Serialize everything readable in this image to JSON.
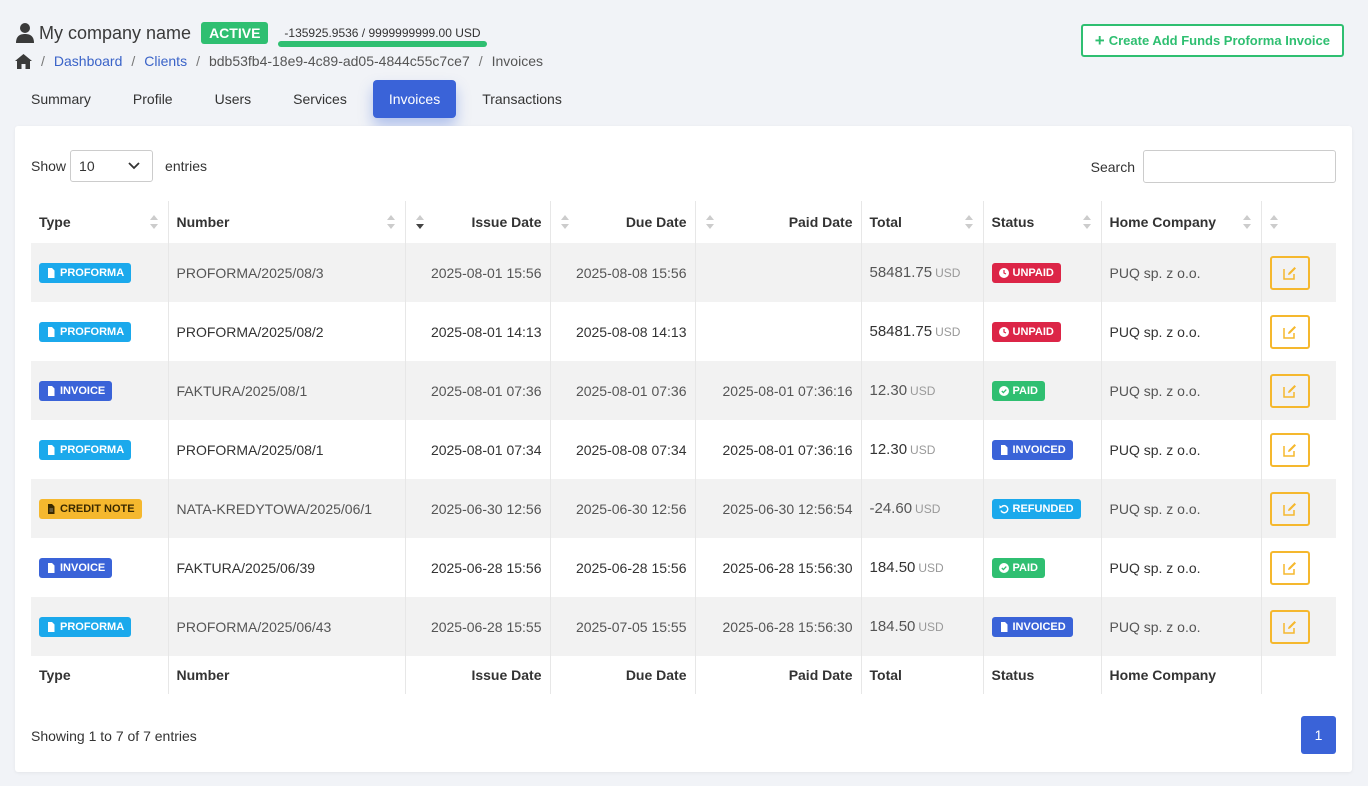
{
  "header": {
    "company_name": "My company name",
    "status": "ACTIVE",
    "balance": "-135925.9536 / 9999999999.00 USD",
    "create_button": "Create Add Funds Proforma Invoice"
  },
  "breadcrumb": {
    "dashboard": "Dashboard",
    "clients": "Clients",
    "client_id": "bdb53fb4-18e9-4c89-ad05-4844c55c7ce7",
    "current": "Invoices"
  },
  "tabs": [
    "Summary",
    "Profile",
    "Users",
    "Services",
    "Invoices",
    "Transactions"
  ],
  "active_tab": "Invoices",
  "table_controls": {
    "show_label": "Show",
    "entries_value": "10",
    "entries_label": "entries",
    "search_label": "Search",
    "search_value": ""
  },
  "columns": [
    "Type",
    "Number",
    "Issue Date",
    "Due Date",
    "Paid Date",
    "Total",
    "Status",
    "Home Company"
  ],
  "rows": [
    {
      "type": "PROFORMA",
      "number": "PROFORMA/2025/08/3",
      "issue": "2025-08-01 15:56",
      "due": "2025-08-08 15:56",
      "paid": "",
      "total": "58481.75",
      "currency": "USD",
      "status": "UNPAID",
      "company": "PUQ sp. z o.o."
    },
    {
      "type": "PROFORMA",
      "number": "PROFORMA/2025/08/2",
      "issue": "2025-08-01 14:13",
      "due": "2025-08-08 14:13",
      "paid": "",
      "total": "58481.75",
      "currency": "USD",
      "status": "UNPAID",
      "company": "PUQ sp. z o.o."
    },
    {
      "type": "INVOICE",
      "number": "FAKTURA/2025/08/1",
      "issue": "2025-08-01 07:36",
      "due": "2025-08-01 07:36",
      "paid": "2025-08-01 07:36:16",
      "total": "12.30",
      "currency": "USD",
      "status": "PAID",
      "company": "PUQ sp. z o.o."
    },
    {
      "type": "PROFORMA",
      "number": "PROFORMA/2025/08/1",
      "issue": "2025-08-01 07:34",
      "due": "2025-08-08 07:34",
      "paid": "2025-08-01 07:36:16",
      "total": "12.30",
      "currency": "USD",
      "status": "INVOICED",
      "company": "PUQ sp. z o.o."
    },
    {
      "type": "CREDIT NOTE",
      "number": "NATA-KREDYTOWA/2025/06/1",
      "issue": "2025-06-30 12:56",
      "due": "2025-06-30 12:56",
      "paid": "2025-06-30 12:56:54",
      "total": "-24.60",
      "currency": "USD",
      "status": "REFUNDED",
      "company": "PUQ sp. z o.o."
    },
    {
      "type": "INVOICE",
      "number": "FAKTURA/2025/06/39",
      "issue": "2025-06-28 15:56",
      "due": "2025-06-28 15:56",
      "paid": "2025-06-28 15:56:30",
      "total": "184.50",
      "currency": "USD",
      "status": "PAID",
      "company": "PUQ sp. z o.o."
    },
    {
      "type": "PROFORMA",
      "number": "PROFORMA/2025/06/43",
      "issue": "2025-06-28 15:55",
      "due": "2025-07-05 15:55",
      "paid": "2025-06-28 15:56:30",
      "total": "184.50",
      "currency": "USD",
      "status": "INVOICED",
      "company": "PUQ sp. z o.o."
    }
  ],
  "footer": {
    "info": "Showing 1 to 7 of 7 entries",
    "page": "1"
  },
  "colors": {
    "primary": "#3a63d8",
    "success": "#2fbf71",
    "info": "#1ba9ec",
    "warning": "#f5b82e",
    "danger": "#dc2547"
  }
}
